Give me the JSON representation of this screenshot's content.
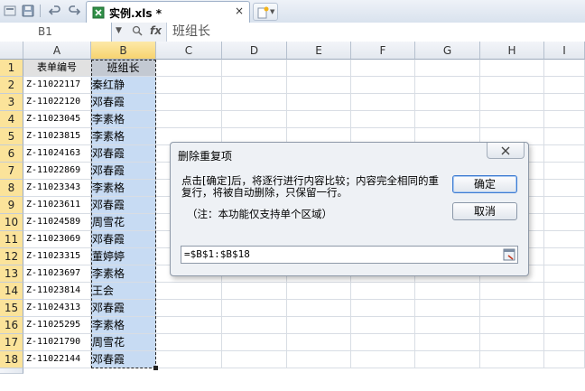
{
  "tab": {
    "filename": "实例.xls *",
    "close": "×"
  },
  "formula_bar": {
    "name_box": "B1",
    "fx_label": "fx",
    "value": "班组长"
  },
  "columns": [
    "A",
    "B",
    "C",
    "D",
    "E",
    "F",
    "G",
    "H",
    "I"
  ],
  "rows": [
    {
      "num": "1",
      "a": "表单编号",
      "b": "班组长"
    },
    {
      "num": "2",
      "a": "Z-11022117",
      "b": "秦红静"
    },
    {
      "num": "3",
      "a": "Z-11022120",
      "b": "邓春霞"
    },
    {
      "num": "4",
      "a": "Z-11023045",
      "b": "李素格"
    },
    {
      "num": "5",
      "a": "Z-11023815",
      "b": "李素格"
    },
    {
      "num": "6",
      "a": "Z-11024163",
      "b": "邓春霞"
    },
    {
      "num": "7",
      "a": "Z-11022869",
      "b": "邓春霞"
    },
    {
      "num": "8",
      "a": "Z-11023343",
      "b": "李素格"
    },
    {
      "num": "9",
      "a": "Z-11023611",
      "b": "邓春霞"
    },
    {
      "num": "10",
      "a": "Z-11024589",
      "b": "周雪花"
    },
    {
      "num": "11",
      "a": "Z-11023069",
      "b": "邓春霞"
    },
    {
      "num": "12",
      "a": "Z-11023315",
      "b": "董婷婷"
    },
    {
      "num": "13",
      "a": "Z-11023697",
      "b": "李素格"
    },
    {
      "num": "14",
      "a": "Z-11023814",
      "b": "王会"
    },
    {
      "num": "15",
      "a": "Z-11024313",
      "b": "邓春霞"
    },
    {
      "num": "16",
      "a": "Z-11025295",
      "b": "李素格"
    },
    {
      "num": "17",
      "a": "Z-11021790",
      "b": "周雪花"
    },
    {
      "num": "18",
      "a": "Z-11022144",
      "b": "邓春霞"
    }
  ],
  "dialog": {
    "title": "删除重复项",
    "message": "点击[确定]后，将逐行进行内容比较；内容完全相同的重复行，将被自动删除，只保留一行。",
    "note": "（注：本功能仅支持单个区域）",
    "ok": "确定",
    "cancel": "取消",
    "range": "=$B$1:$B$18"
  },
  "colors": {
    "selection": "#c7dbf3",
    "header_selected": "#fbe39a",
    "dialog_bg": "#eef1f5"
  },
  "icons": [
    "save-icon",
    "undo-icon",
    "redo-icon",
    "spreadsheet-icon",
    "new-tab-icon",
    "zoom-icon",
    "fx-icon",
    "close-icon",
    "range-picker-icon"
  ]
}
